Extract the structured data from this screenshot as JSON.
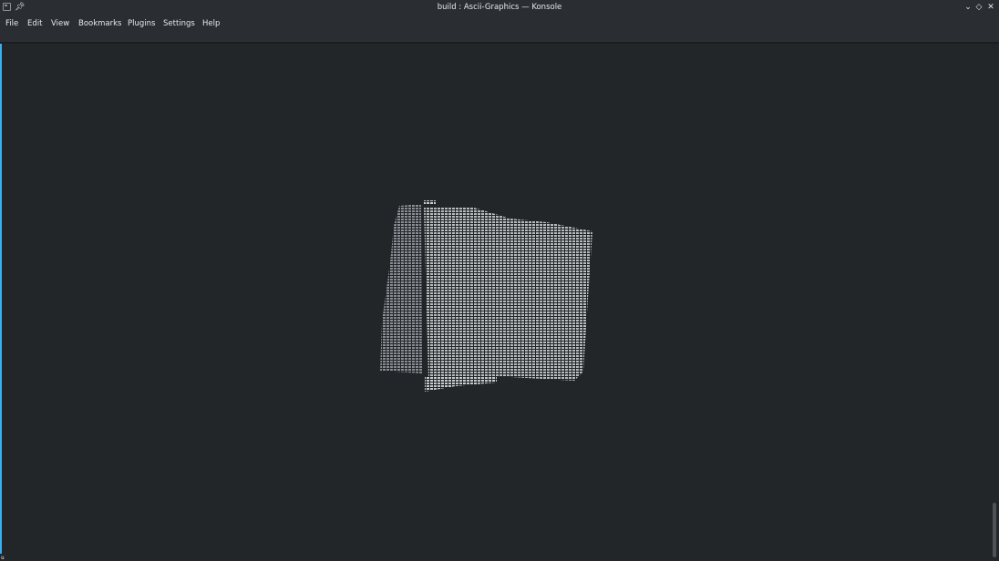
{
  "window": {
    "title": "build : Ascii-Graphics — Konsole",
    "controls": {
      "minimize": "⌄",
      "maximize": "◇",
      "close": "✕"
    }
  },
  "menubar": {
    "items": [
      {
        "label": "File"
      },
      {
        "label": "Edit"
      },
      {
        "label": "View"
      },
      {
        "label": "Bookmarks"
      },
      {
        "label": "Plugins"
      },
      {
        "label": "Settings"
      },
      {
        "label": "Help"
      }
    ]
  },
  "terminal": {
    "cursor_glyph": "u",
    "render_color": "#c8cbce",
    "accent": "#3daee9"
  },
  "icons": {
    "app": "konsole-icon",
    "pin": "pin-icon"
  }
}
